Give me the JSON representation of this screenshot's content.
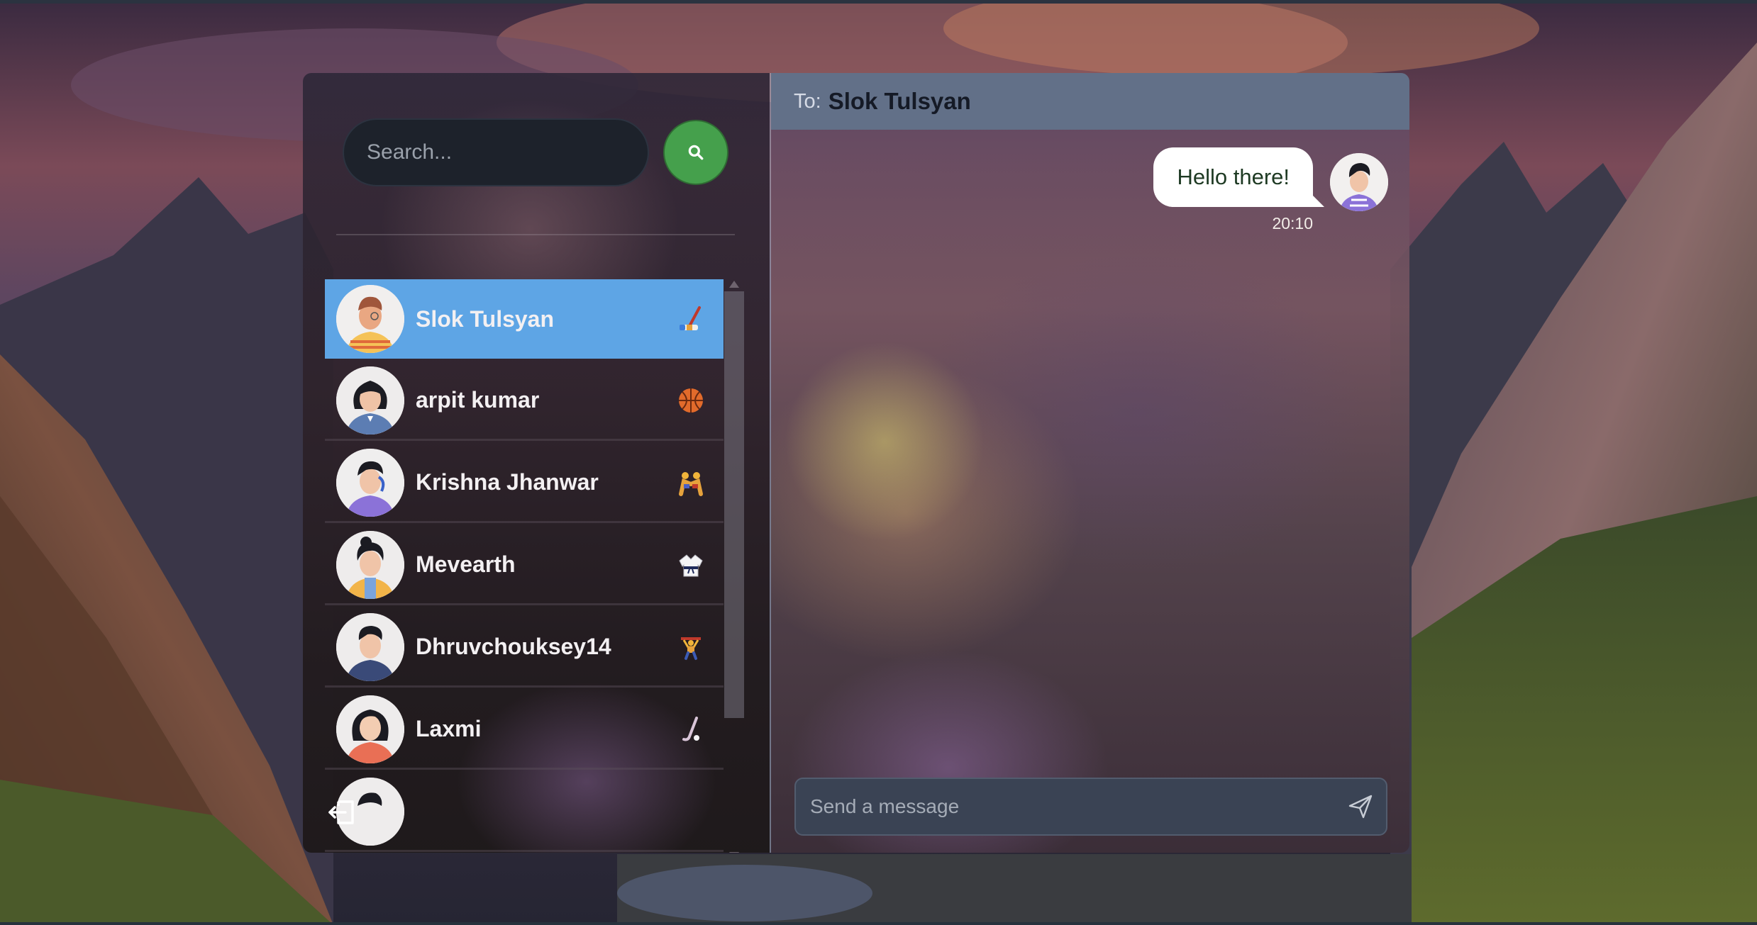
{
  "search": {
    "placeholder": "Search...",
    "button_icon": "search-icon"
  },
  "contacts": [
    {
      "name": "Slok Tulsyan",
      "emoji": "hockey-stick-icon",
      "active": true
    },
    {
      "name": "arpit kumar",
      "emoji": "basketball-icon",
      "active": false
    },
    {
      "name": "Krishna Jhanwar",
      "emoji": "wrestling-icon",
      "active": false
    },
    {
      "name": "Mevearth",
      "emoji": "martial-arts-uniform-icon",
      "active": false
    },
    {
      "name": "Dhruvchouksey14",
      "emoji": "weightlifting-icon",
      "active": false
    },
    {
      "name": "Laxmi",
      "emoji": "field-hockey-icon",
      "active": false
    }
  ],
  "chat": {
    "to_label": "To:",
    "to_name": "Slok Tulsyan",
    "messages": [
      {
        "text": "Hello there!",
        "time": "20:10",
        "from_me": true
      }
    ],
    "composer_placeholder": "Send a message"
  },
  "colors": {
    "active_contact": "#5ea5e5",
    "search_button": "#45a04c",
    "chat_header": "#627088"
  }
}
